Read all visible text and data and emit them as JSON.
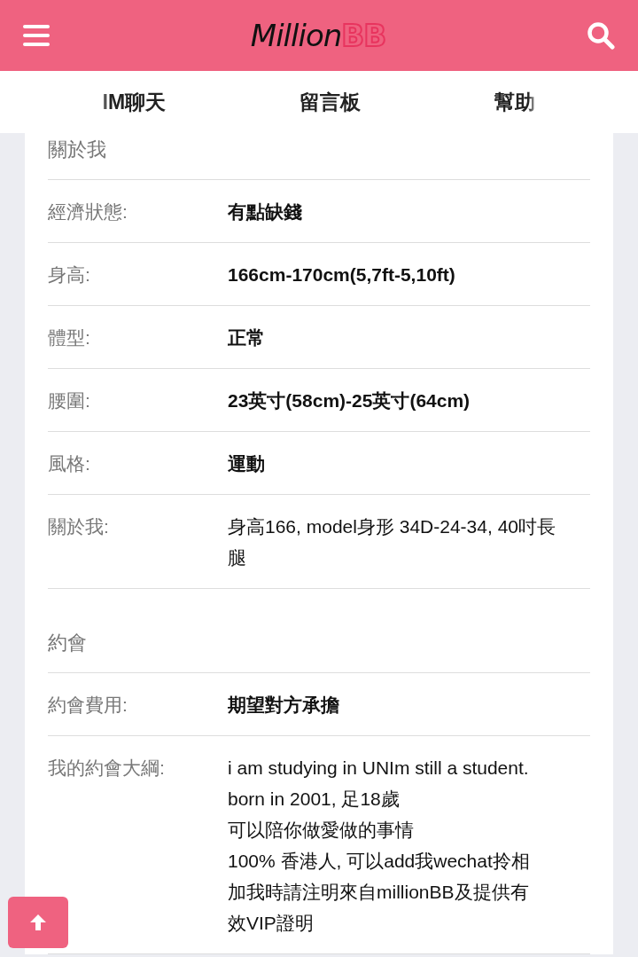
{
  "header": {
    "logo_script": "Million",
    "logo_accent": "BB"
  },
  "tabs": [
    {
      "label": "IM聊天"
    },
    {
      "label": "留言板"
    },
    {
      "label": "幫助"
    }
  ],
  "sections": [
    {
      "title": "關於我",
      "rows": [
        {
          "label": "經濟狀態:",
          "bold": true,
          "lines": [
            "有點缺錢"
          ]
        },
        {
          "label": "身高:",
          "bold": true,
          "lines": [
            "166cm-170cm(5,7ft-5,10ft)"
          ]
        },
        {
          "label": "體型:",
          "bold": true,
          "lines": [
            "正常"
          ]
        },
        {
          "label": "腰圍:",
          "bold": true,
          "lines": [
            "23英寸(58cm)-25英寸(64cm)"
          ]
        },
        {
          "label": "風格:",
          "bold": true,
          "lines": [
            "運動"
          ]
        },
        {
          "label": "關於我:",
          "bold": false,
          "lines": [
            "身高166, model身形 34D-24-34, 40吋長腿"
          ]
        }
      ]
    },
    {
      "title": "約會",
      "rows": [
        {
          "label": "約會費用:",
          "bold": true,
          "lines": [
            "期望對方承擔"
          ]
        },
        {
          "label": "我的約會大綱:",
          "bold": false,
          "lines": [
            "i am studying in UNIm still a student.",
            "born in 2001, 足18歲",
            "可以陪你做愛做的事情",
            "100% 香港人, 可以add我wechat拎相",
            "加我時請注明來自millionBB及提供有",
            "效VIP證明"
          ]
        }
      ]
    }
  ]
}
